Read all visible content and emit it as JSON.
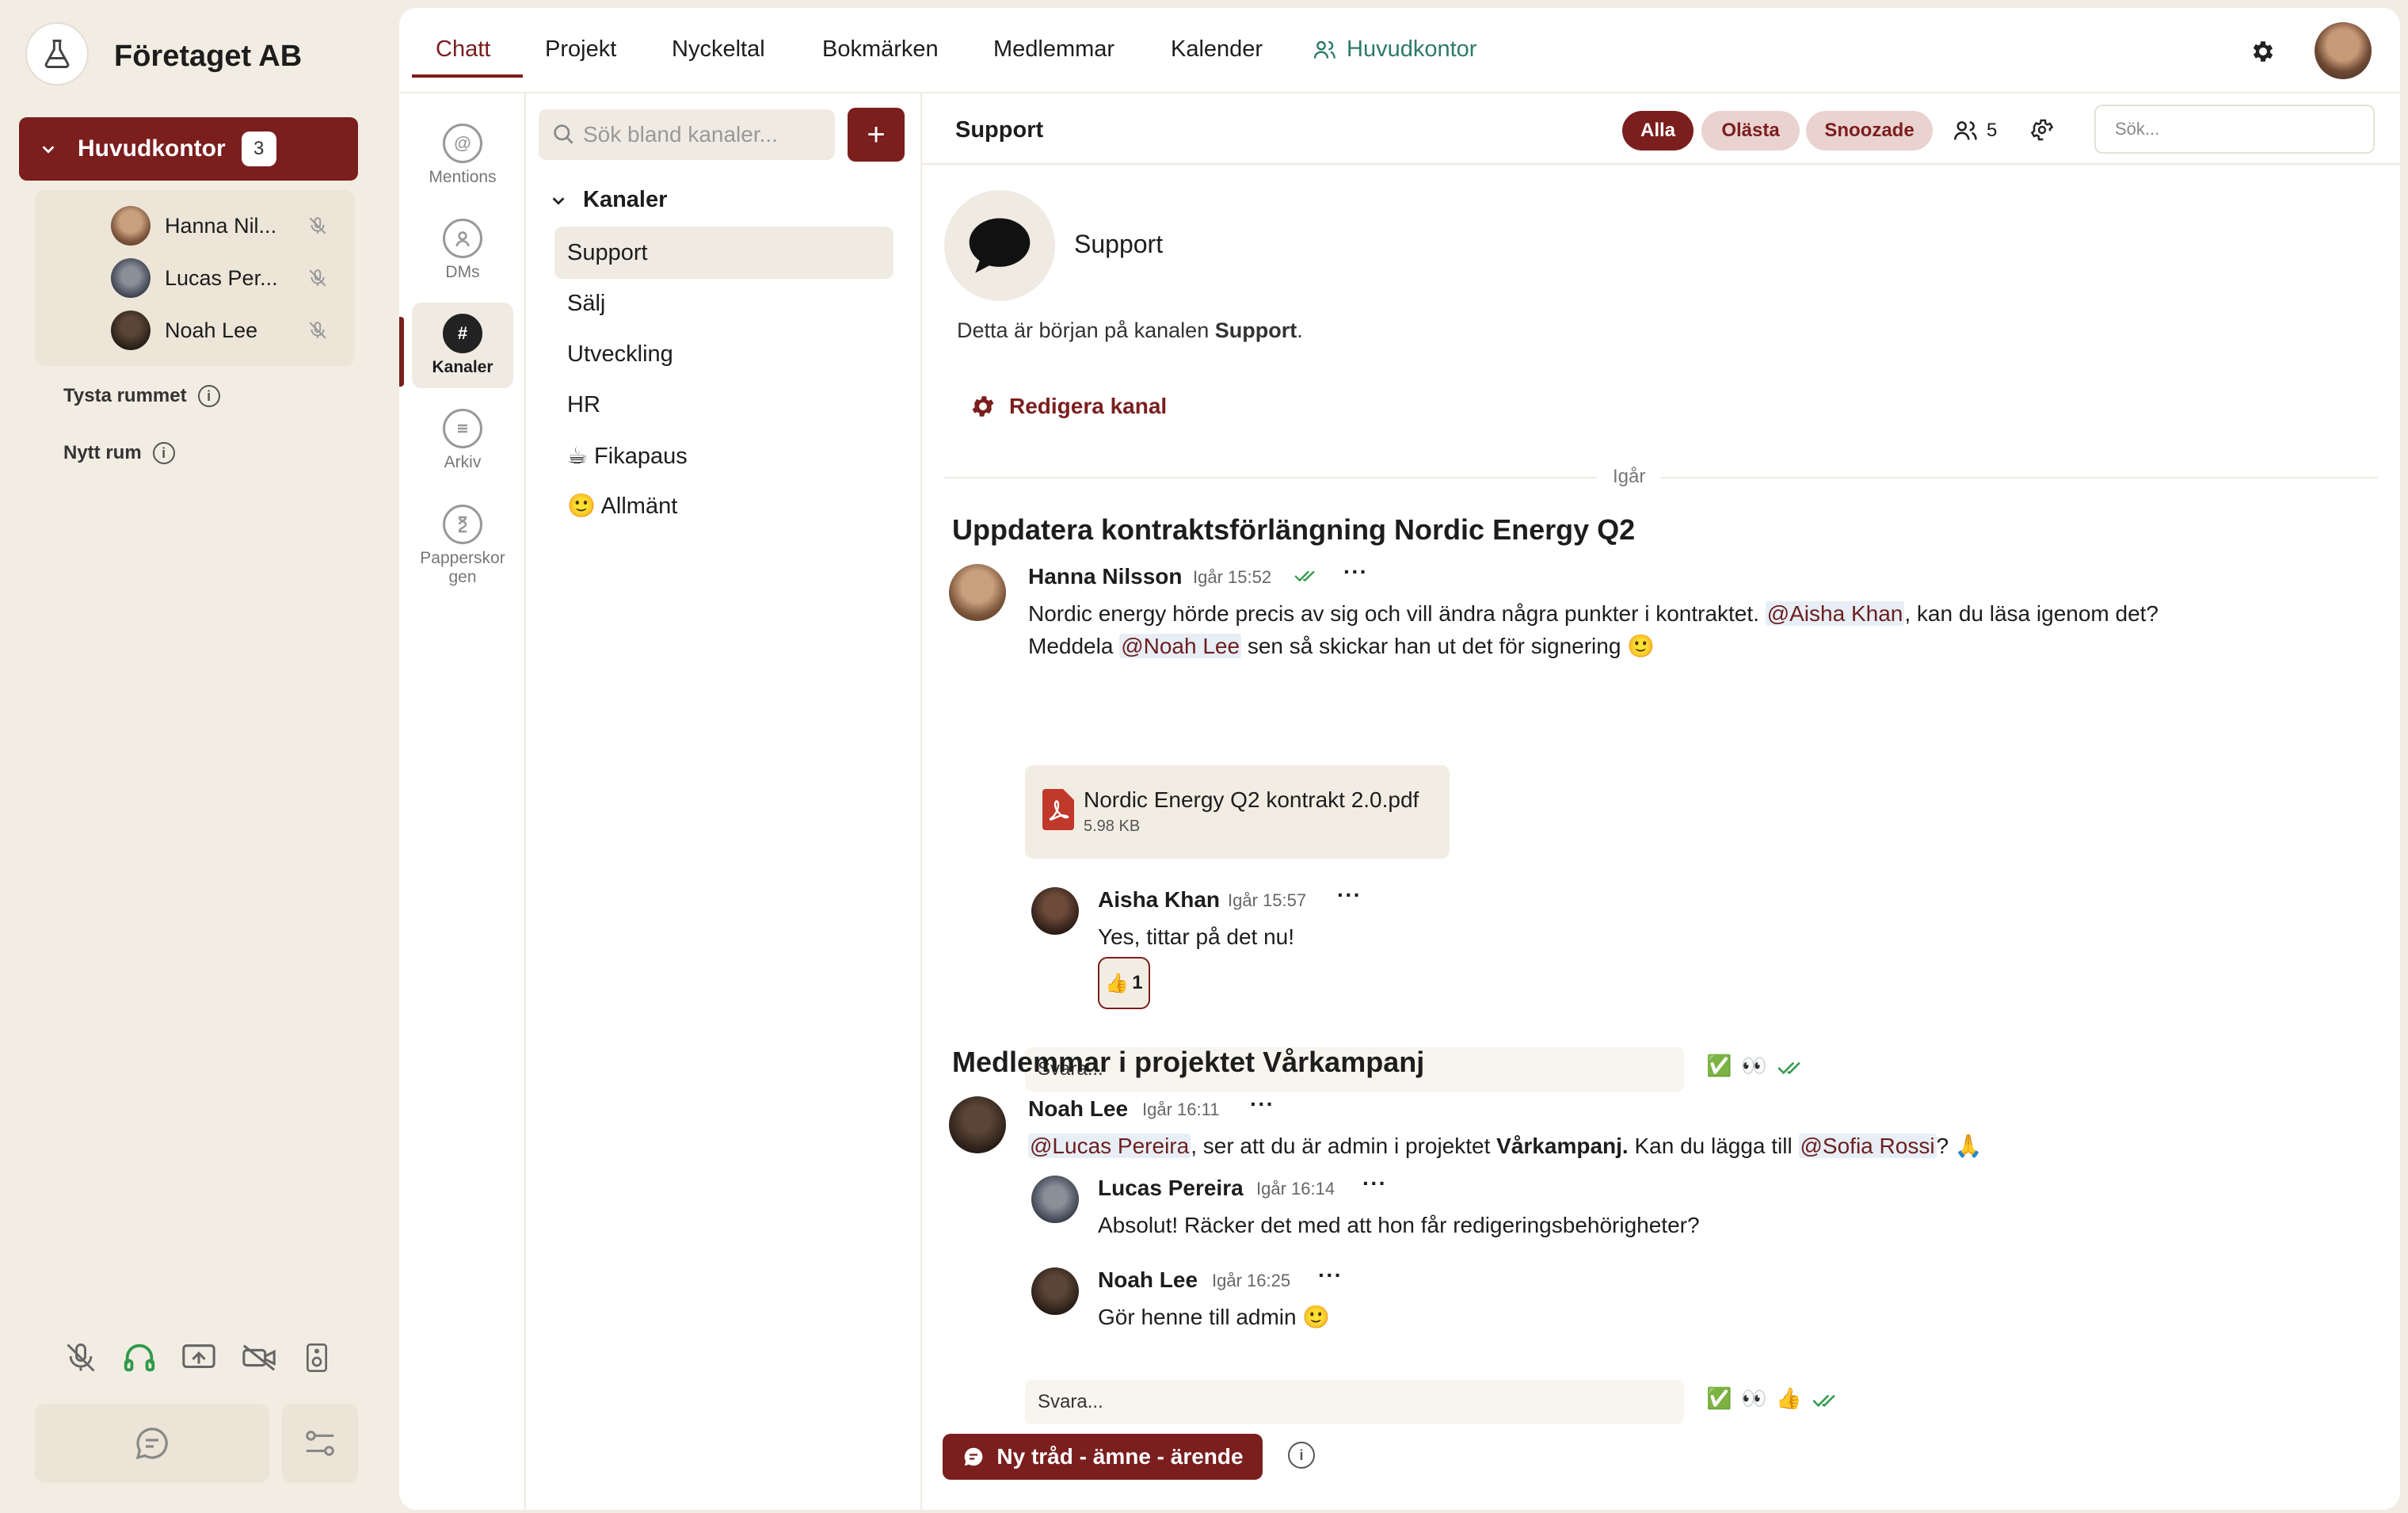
{
  "workspace": {
    "name": "Företaget AB"
  },
  "sidebar": {
    "room_button": {
      "label": "Huvudkontor",
      "count": "3"
    },
    "members": [
      {
        "name": "Hanna Nil..."
      },
      {
        "name": "Lucas Per..."
      },
      {
        "name": "Noah Lee"
      }
    ],
    "links": [
      {
        "label": "Tysta rummet"
      },
      {
        "label": "Nytt rum"
      }
    ]
  },
  "topnav": {
    "tabs": [
      "Chatt",
      "Projekt",
      "Nyckeltal",
      "Bokmärken",
      "Medlemmar",
      "Kalender"
    ],
    "room_label": "Huvudkontor"
  },
  "rail": {
    "items": [
      "Mentions",
      "DMs",
      "Kanaler",
      "Arkiv",
      "Papperskor gen"
    ]
  },
  "channels": {
    "search_placeholder": "Sök bland kanaler...",
    "add_label": "+",
    "heading": "Kanaler",
    "list": [
      {
        "label": "Support"
      },
      {
        "label": "Sälj"
      },
      {
        "label": "Utveckling"
      },
      {
        "label": "HR"
      },
      {
        "label": "☕ Fikapaus"
      },
      {
        "label": "🙂 Allmänt"
      }
    ]
  },
  "channel_header": {
    "title": "Support",
    "filters": [
      "Alla",
      "Olästa",
      "Snoozade"
    ],
    "member_count": "5",
    "search_placeholder": "Sök..."
  },
  "channel_intro": {
    "name": "Support",
    "begin_text_prefix": "Detta är början på kanalen ",
    "begin_text_channel": "Support",
    "begin_text_suffix": ".",
    "edit_label": "Redigera kanal",
    "day_label": "Igår"
  },
  "threads": [
    {
      "title": "Uppdatera kontraktsförlängning Nordic Energy Q2",
      "message": {
        "author": "Hanna Nilsson",
        "time": "Igår 15:52",
        "line1_a": "Nordic energy hörde precis av sig och vill ändra några punkter i kontraktet. ",
        "mention1": "@Aisha Khan",
        "line1_b": ", kan du läsa igenom det?",
        "line2_a": "Meddela ",
        "mention2": "@Noah Lee",
        "line2_b": " sen så skickar han ut det för signering 🙂"
      },
      "attachment": {
        "name": "Nordic Energy Q2 kontrakt 2.0.pdf",
        "size": "5.98 KB"
      },
      "reply": {
        "author": "Aisha Khan",
        "time": "Igår 15:57",
        "text": "Yes, tittar på det nu!",
        "reaction_emoji": "👍",
        "reaction_count": "1"
      },
      "reply_placeholder": "Svara...",
      "quick_reactions": [
        "✅",
        "👀"
      ]
    },
    {
      "title": "Medlemmar i projektet Vårkampanj",
      "message": {
        "author": "Noah Lee",
        "time": "Igår 16:11",
        "mention1": "@Lucas Pereira",
        "text_a": ", ser att du är admin i projektet ",
        "bold": "Vårkampanj.",
        "text_b": " Kan du lägga till ",
        "mention2": "@Sofia Rossi",
        "text_c": "? 🙏"
      },
      "replies": [
        {
          "author": "Lucas Pereira",
          "time": "Igår 16:14",
          "text": "Absolut! Räcker det med att hon får redigeringsbehörigheter?"
        },
        {
          "author": "Noah Lee",
          "time": "Igår 16:25",
          "text": "Gör henne till admin 🙂"
        }
      ],
      "reply_placeholder": "Svara...",
      "quick_reactions": [
        "✅",
        "👀",
        "👍"
      ]
    }
  ],
  "new_thread_label": "Ny tråd - ämne - ärende",
  "colors": {
    "accent": "#7b1e1e",
    "background": "#f2ede3",
    "mention_bg": "#e8eef5",
    "online": "#2e9a4a"
  }
}
